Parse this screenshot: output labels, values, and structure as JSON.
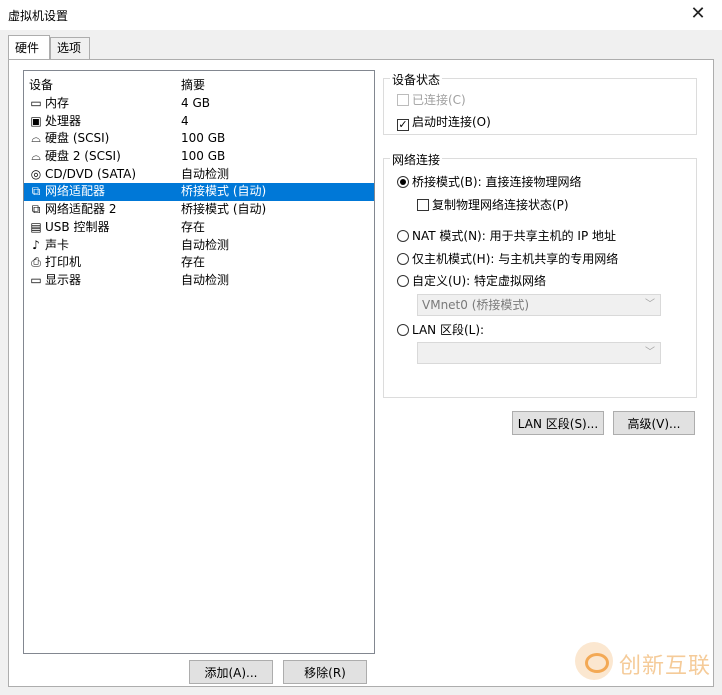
{
  "window": {
    "title": "虚拟机设置",
    "close_glyph": "✕"
  },
  "tabs": [
    {
      "label": "硬件",
      "active": true
    },
    {
      "label": "选项",
      "active": false
    }
  ],
  "device_list": {
    "columns": {
      "device": "设备",
      "summary": "摘要"
    },
    "rows": [
      {
        "icon": "memory-icon",
        "glyph": "▭",
        "name": "内存",
        "summary": "4 GB"
      },
      {
        "icon": "processor-icon",
        "glyph": "▣",
        "name": "处理器",
        "summary": "4"
      },
      {
        "icon": "hard-disk-icon",
        "glyph": "⌓",
        "name": "硬盘 (SCSI)",
        "summary": "100 GB"
      },
      {
        "icon": "hard-disk-icon",
        "glyph": "⌓",
        "name": "硬盘 2 (SCSI)",
        "summary": "100 GB"
      },
      {
        "icon": "cd-dvd-icon",
        "glyph": "◎",
        "name": "CD/DVD (SATA)",
        "summary": "自动检测"
      },
      {
        "icon": "network-adapter-icon",
        "glyph": "⧉",
        "name": "网络适配器",
        "summary": "桥接模式 (自动)",
        "selected": true
      },
      {
        "icon": "network-adapter-icon",
        "glyph": "⧉",
        "name": "网络适配器 2",
        "summary": "桥接模式 (自动)"
      },
      {
        "icon": "usb-icon",
        "glyph": "▤",
        "name": "USB 控制器",
        "summary": "存在"
      },
      {
        "icon": "sound-card-icon",
        "glyph": "♪",
        "name": "声卡",
        "summary": "自动检测"
      },
      {
        "icon": "printer-icon",
        "glyph": "⎙",
        "name": "打印机",
        "summary": "存在"
      },
      {
        "icon": "display-icon",
        "glyph": "▭",
        "name": "显示器",
        "summary": "自动检测"
      }
    ]
  },
  "buttons": {
    "add": "添加(A)...",
    "remove": "移除(R)",
    "lan_segments": "LAN 区段(S)...",
    "advanced": "高级(V)..."
  },
  "device_status": {
    "legend": "设备状态",
    "connected": {
      "label": "已连接(C)",
      "checked": false,
      "enabled": false
    },
    "connect_at_power_on": {
      "label": "启动时连接(O)",
      "checked": true
    }
  },
  "network_connection": {
    "legend": "网络连接",
    "bridged": {
      "label": "桥接模式(B): 直接连接物理网络",
      "selected": true
    },
    "replicate": {
      "label": "复制物理网络连接状态(P)",
      "checked": false
    },
    "nat": {
      "label": "NAT 模式(N): 用于共享主机的 IP 地址"
    },
    "host_only": {
      "label": "仅主机模式(H): 与主机共享的专用网络"
    },
    "custom": {
      "label": "自定义(U): 特定虚拟网络",
      "dropdown_value": "VMnet0 (桥接模式)"
    },
    "lan_segment": {
      "label": "LAN 区段(L):",
      "dropdown_value": ""
    }
  },
  "watermark": {
    "text": "创新互联"
  }
}
